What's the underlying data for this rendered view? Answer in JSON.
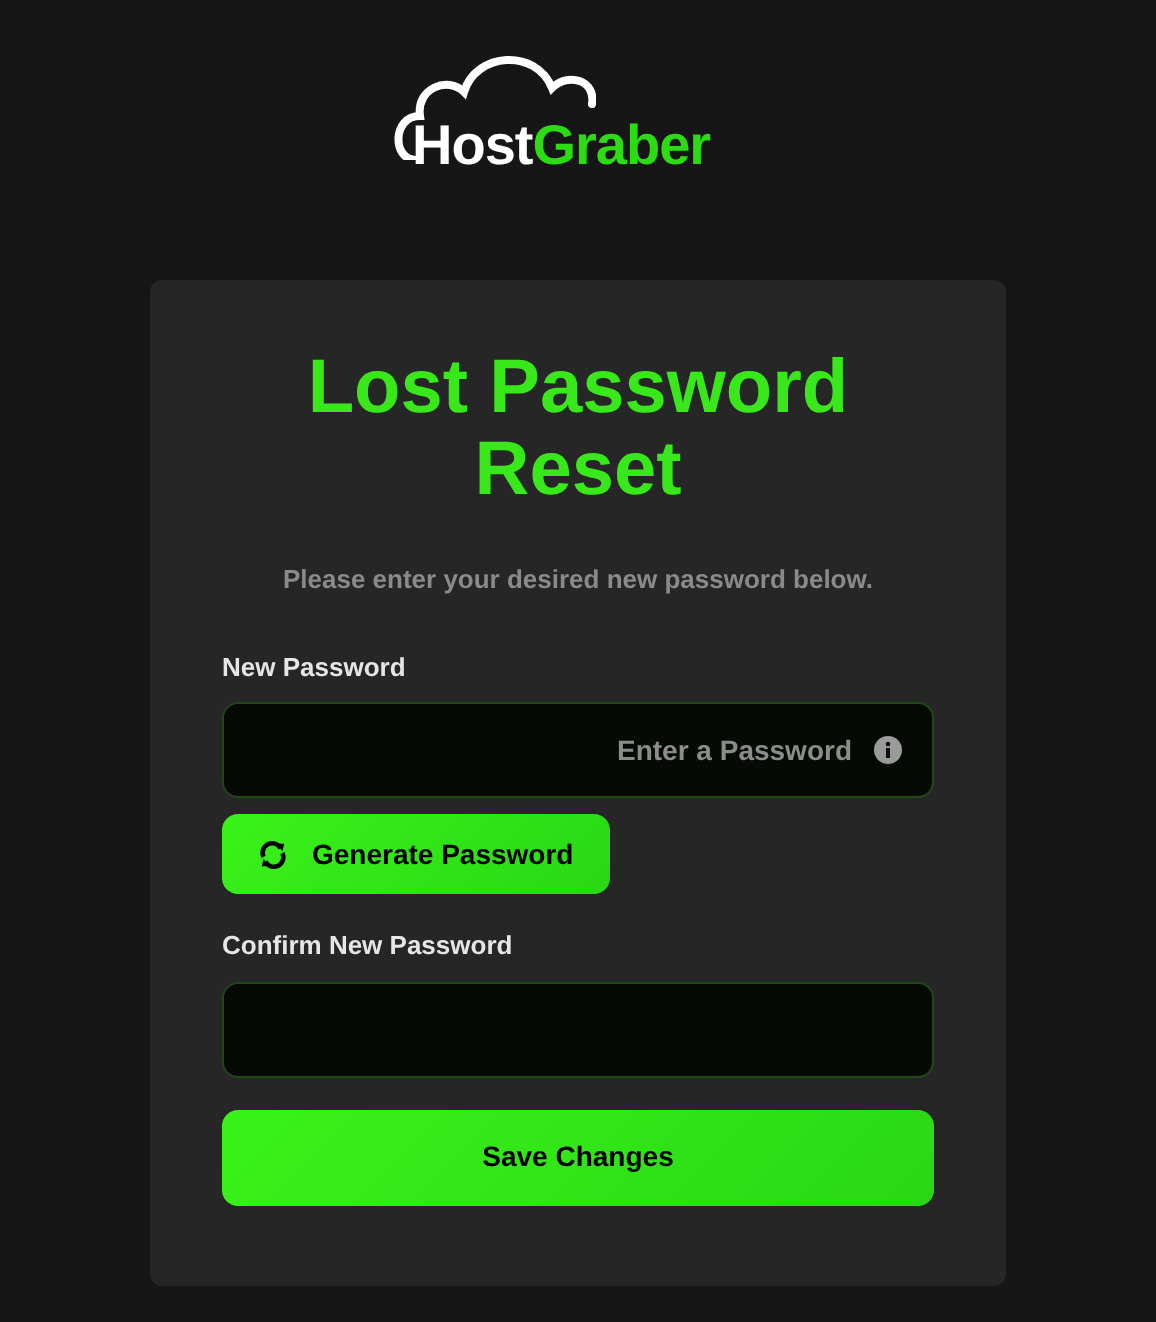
{
  "logo": {
    "first": "Host",
    "second": "Graber"
  },
  "title": "Lost Password Reset",
  "subtitle": "Please enter your desired new password below.",
  "fields": [
    {
      "label": "New Password",
      "placeholder": "Enter a Password",
      "kind": "info"
    },
    {
      "label": "Confirm New Password",
      "kind": "plain"
    }
  ],
  "generate_button": "Generate Password",
  "save_button": "Save Changes"
}
